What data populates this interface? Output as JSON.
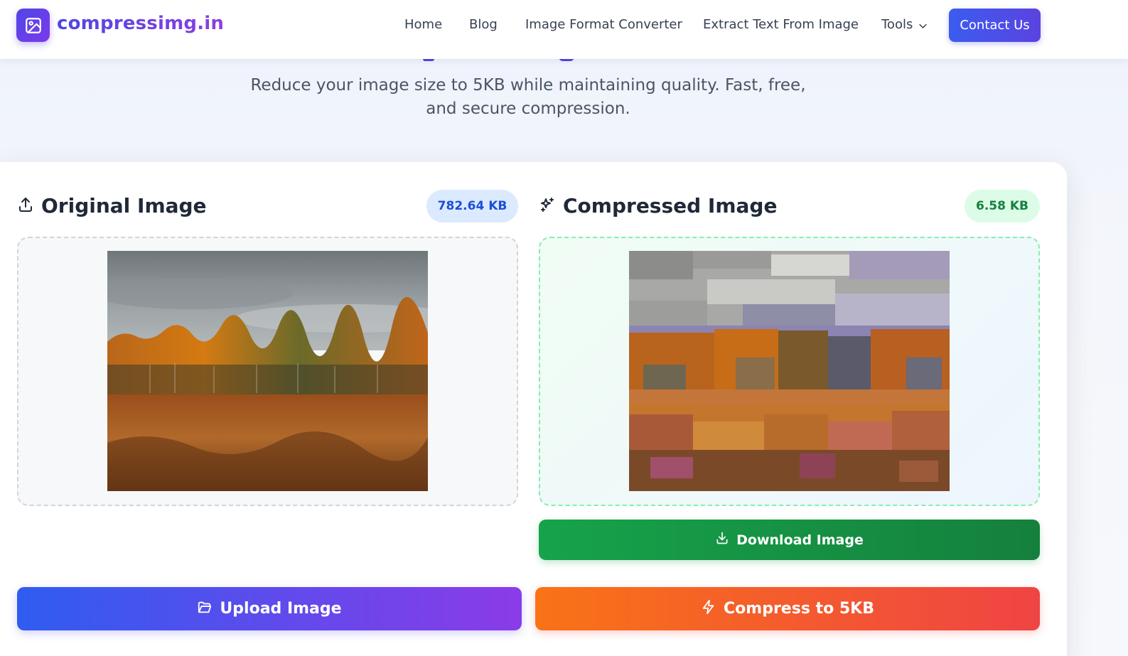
{
  "nav": {
    "logo_text": "compressimg.in",
    "links": [
      "Home",
      "Blog",
      "Image Format Converter",
      "Extract Text From Image"
    ],
    "tools_label": "Tools",
    "contact_label": "Contact Us"
  },
  "hero": {
    "subtitle": "Reduce your image size to 5KB while maintaining quality. Fast, free, and secure compression."
  },
  "original": {
    "title": "Original Image",
    "size": "782.64 KB"
  },
  "compressed": {
    "title": "Compressed Image",
    "size": "6.58 KB"
  },
  "buttons": {
    "download": "Download Image",
    "upload": "Upload Image",
    "compress": "Compress to 5KB"
  },
  "colors": {
    "brand_indigo": "#4f46e5",
    "brand_purple": "#7c3aed",
    "download_green": "#16a34a",
    "compress_orange": "#f97316",
    "compress_red": "#ef4444"
  },
  "icons": {
    "logo": "image-icon",
    "tools": "chevron-down-icon",
    "original": "upload-icon",
    "compressed": "sparkles-icon",
    "download": "download-icon",
    "upload": "folder-open-icon",
    "compress": "zap-icon"
  }
}
